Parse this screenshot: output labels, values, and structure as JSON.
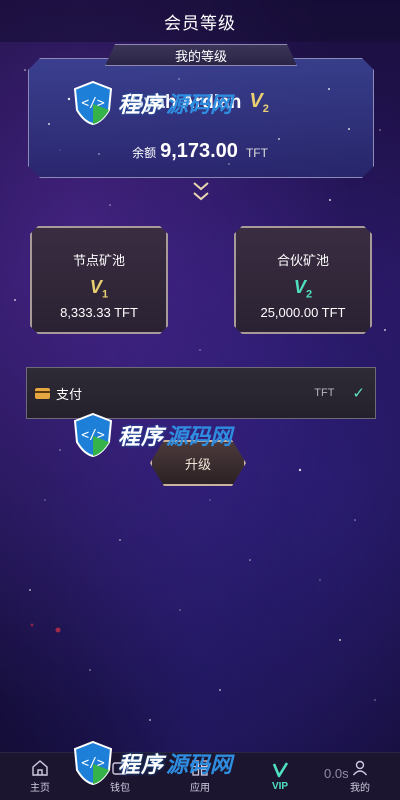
{
  "header": {
    "title": "会员等级"
  },
  "level_card": {
    "tab_label": "我的等级",
    "username": "Syah Ardian",
    "level_letter": "V",
    "level_number": "2",
    "balance_label": "余额",
    "balance_value": "9,173.00",
    "balance_unit": "TFT"
  },
  "pools": [
    {
      "name": "节点矿池",
      "level_letter": "V",
      "level_number": "1",
      "amount": "8,333.33 TFT",
      "color": "#e8d070"
    },
    {
      "name": "合伙矿池",
      "level_letter": "V",
      "level_number": "2",
      "amount": "25,000.00 TFT",
      "color": "#4fe0c0"
    }
  ],
  "payment": {
    "label": "支付",
    "unit": "TFT",
    "selected": true
  },
  "upgrade_button": {
    "label": "升级"
  },
  "watermark": {
    "text": "程序源码网",
    "text_a": "程序",
    "text_b": "源码网"
  },
  "nav": {
    "items": [
      {
        "label": "主页",
        "icon": "home-icon"
      },
      {
        "label": "钱包",
        "icon": "wallet-icon"
      },
      {
        "label": "应用",
        "icon": "apps-icon"
      },
      {
        "label": "VIP",
        "icon": "vip-icon",
        "active": true
      },
      {
        "label": "我的",
        "icon": "user-icon"
      }
    ]
  },
  "timer_text": "0.0s",
  "colors": {
    "accent": "#4fe0c0",
    "gold": "#e8d070",
    "bg": "#1d1450"
  }
}
